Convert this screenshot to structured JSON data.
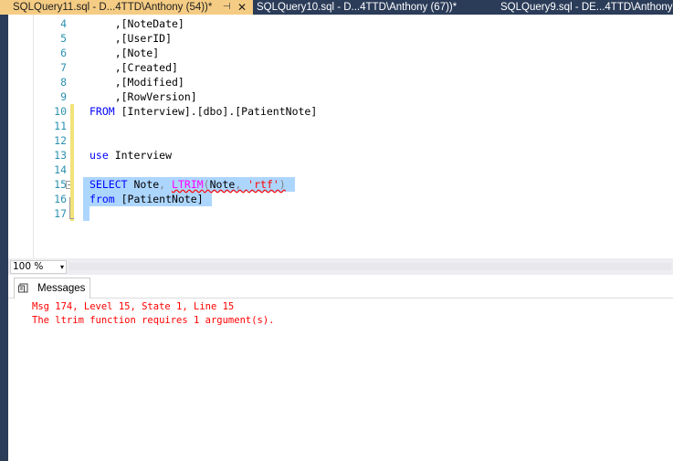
{
  "tabs": [
    {
      "title": "SQLQuery11.sql - D...4TTD\\Anthony (54))*",
      "active": true,
      "pin_glyph": "⊣",
      "close_glyph": "✕"
    },
    {
      "title": "SQLQuery10.sql - D...4TTD\\Anthony (67))*",
      "active": false
    },
    {
      "title": "SQLQuery9.sql - DE...4TTD\\Anthony",
      "active": false
    }
  ],
  "editor": {
    "lines": [
      {
        "num": "4",
        "text": "    ,[NoteDate]"
      },
      {
        "num": "5",
        "text": "    ,[UserID]"
      },
      {
        "num": "6",
        "text": "    ,[Note]"
      },
      {
        "num": "7",
        "text": "    ,[Created]"
      },
      {
        "num": "8",
        "text": "    ,[Modified]"
      },
      {
        "num": "9",
        "text": "    ,[RowVersion]"
      },
      {
        "num": "10",
        "kw": "FROM",
        "rest": " [Interview].[dbo].[PatientNote]"
      },
      {
        "num": "11",
        "text": ""
      },
      {
        "num": "12",
        "text": ""
      },
      {
        "num": "13",
        "kw": "use",
        "rest": " Interview"
      },
      {
        "num": "14",
        "text": ""
      },
      {
        "num": "15",
        "kw": "SELECT",
        "p1": " Note",
        "comma": ",",
        "fn": "LTRIM",
        "open": "(",
        "arg1": "Note",
        "comma2": ", ",
        "str": "'rtf'",
        "close": ")"
      },
      {
        "num": "16",
        "kw": "from",
        "rest": " [PatientNote]"
      },
      {
        "num": "17",
        "text": ""
      }
    ]
  },
  "zoom": {
    "value": "100 %",
    "arrow": "▾"
  },
  "results": {
    "tab_label": "Messages",
    "messages": [
      "Msg 174, Level 15, State 1, Line 15",
      "The ltrim function requires 1 argument(s)."
    ]
  },
  "colors": {
    "active_tab": "#f5cc84",
    "tab_strip": "#2b3c59",
    "line_number": "#2b91af",
    "keyword": "#0000ff",
    "function": "#ff00ff",
    "string": "#ff0000",
    "selection": "#add6ff",
    "error_text": "#ff0000"
  }
}
